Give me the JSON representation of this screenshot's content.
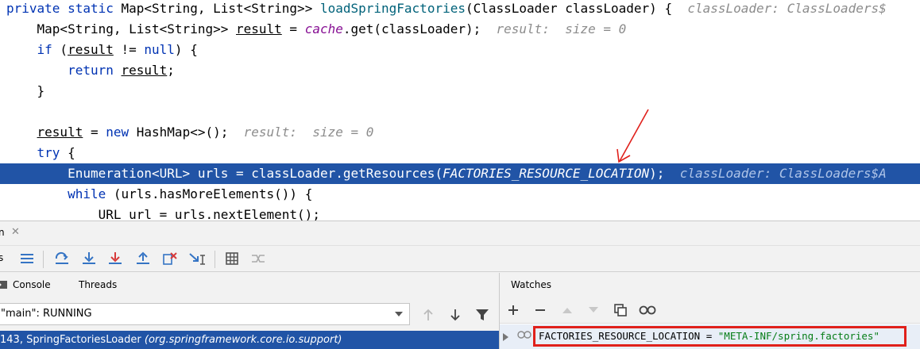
{
  "editor": {
    "lines": [
      {
        "parts": [
          {
            "t": "private static ",
            "c": "kw"
          },
          {
            "t": "Map<String, List<String>> "
          },
          {
            "t": "loadSpringFactories",
            "c": "fn"
          },
          {
            "t": "(ClassLoader classLoader) {  "
          },
          {
            "t": "classLoader: ClassLoaders$",
            "c": "hint"
          }
        ]
      },
      {
        "parts": [
          {
            "t": "    Map<String, List<String>> "
          },
          {
            "t": "result",
            "c": "ul"
          },
          {
            "t": " = "
          },
          {
            "t": "cache",
            "c": "st"
          },
          {
            "t": ".get(classLoader);  "
          },
          {
            "t": "result:  size = 0",
            "c": "hint"
          }
        ]
      },
      {
        "parts": [
          {
            "t": "    "
          },
          {
            "t": "if",
            "c": "kw"
          },
          {
            "t": " ("
          },
          {
            "t": "result",
            "c": "ul"
          },
          {
            "t": " != "
          },
          {
            "t": "null",
            "c": "kw"
          },
          {
            "t": ") {"
          }
        ]
      },
      {
        "parts": [
          {
            "t": "        "
          },
          {
            "t": "return ",
            "c": "kw"
          },
          {
            "t": "result",
            "c": "ul"
          },
          {
            "t": ";"
          }
        ]
      },
      {
        "parts": [
          {
            "t": "    }"
          }
        ]
      },
      {
        "parts": [
          {
            "t": ""
          }
        ]
      },
      {
        "parts": [
          {
            "t": "    "
          },
          {
            "t": "result",
            "c": "ul"
          },
          {
            "t": " = "
          },
          {
            "t": "new ",
            "c": "kw"
          },
          {
            "t": "HashMap<>();  "
          },
          {
            "t": "result:  size = 0",
            "c": "hint"
          }
        ]
      },
      {
        "parts": [
          {
            "t": "    "
          },
          {
            "t": "try",
            "c": "kw"
          },
          {
            "t": " {"
          }
        ]
      },
      {
        "exec": true,
        "parts": [
          {
            "t": "        Enumeration<URL> urls = classLoader.getResources("
          },
          {
            "t": "FACTORIES_RESOURCE_LOCATION",
            "c": "st"
          },
          {
            "t": ");  "
          },
          {
            "t": "classLoader: ClassLoaders$A",
            "c": "hint"
          }
        ]
      },
      {
        "parts": [
          {
            "t": "        "
          },
          {
            "t": "while",
            "c": "kw"
          },
          {
            "t": " (urls.hasMoreElements()) {"
          }
        ]
      },
      {
        "parts": [
          {
            "t": "            URL url = urls.nextElement();"
          }
        ]
      }
    ]
  },
  "debug": {
    "title_label": "n",
    "close_icon": "✕",
    "toolbar_label": "s",
    "tabs": {
      "console": "Console",
      "threads": "Threads"
    },
    "thread_select": "\"main\": RUNNING",
    "frame": {
      "location": "143, SpringFactoriesLoader ",
      "package": "(org.springframework.core.io.support)"
    },
    "watches": {
      "title": "Watches",
      "item": {
        "name": "FACTORIES_RESOURCE_LOCATION",
        "eq": " = ",
        "value": "\"META-INF/spring.factories\""
      }
    }
  },
  "colors": {
    "selection": "#2154a6",
    "highlight_box": "#e0201b",
    "annotation_arrow": "#e0201b"
  }
}
